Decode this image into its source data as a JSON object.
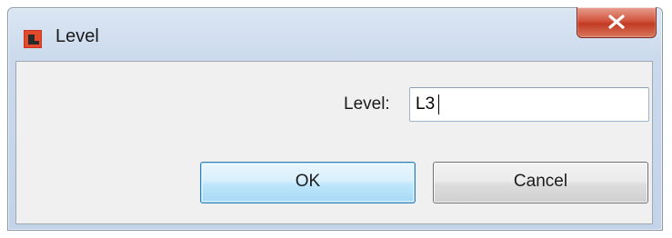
{
  "window": {
    "title": "Level",
    "icon": "app-icon",
    "close_glyph": "X"
  },
  "form": {
    "level_label": "Level:",
    "level_value": "L3"
  },
  "buttons": {
    "ok_label": "OK",
    "cancel_label": "Cancel"
  }
}
